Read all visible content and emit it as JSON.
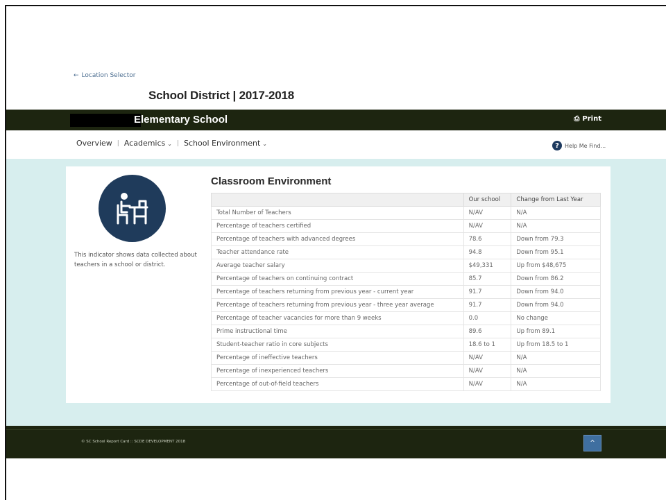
{
  "location_link": {
    "arrow": "←",
    "label": "Location Selector"
  },
  "district_title": "School District | 2017-2018",
  "school_bar": {
    "school_name": "Elementary School",
    "print_icon": "printer-icon",
    "print_label": "Print"
  },
  "nav": {
    "items": [
      {
        "label": "Overview",
        "dropdown": false
      },
      {
        "label": "Academics",
        "dropdown": true
      },
      {
        "label": "School Environment",
        "dropdown": true
      }
    ],
    "help_label": "Help Me Find..."
  },
  "indicator": {
    "icon": "teacher-at-desk-icon",
    "description": "This indicator shows data collected about teachers in a school or district."
  },
  "section": {
    "title": "Classroom Environment",
    "columns": [
      "",
      "Our school",
      "Change from Last Year"
    ],
    "rows": [
      {
        "label": "Total Number of Teachers",
        "value": "N/AV",
        "change": "N/A"
      },
      {
        "label": "Percentage of teachers certified",
        "value": "N/AV",
        "change": "N/A"
      },
      {
        "label": "Percentage of teachers with advanced degrees",
        "value": "78.6",
        "change": "Down from 79.3"
      },
      {
        "label": "Teacher attendance rate",
        "value": "94.8",
        "change": "Down from 95.1"
      },
      {
        "label": "Average teacher salary",
        "value": "$49,331",
        "change": "Up from $48,675"
      },
      {
        "label": "Percentage of teachers on continuing contract",
        "value": "85.7",
        "change": "Down from 86.2"
      },
      {
        "label": "Percentage of teachers returning from previous year - current year",
        "value": "91.7",
        "change": "Down from 94.0"
      },
      {
        "label": "Percentage of teachers returning from previous year - three year average",
        "value": "91.7",
        "change": "Down from 94.0"
      },
      {
        "label": "Percentage of teacher vacancies for more than 9 weeks",
        "value": "0.0",
        "change": "No change"
      },
      {
        "label": "Prime instructional time",
        "value": "89.6",
        "change": "Up from 89.1"
      },
      {
        "label": "Student-teacher ratio in core subjects",
        "value": "18.6 to 1",
        "change": "Up from 18.5 to 1"
      },
      {
        "label": "Percentage of ineffective teachers",
        "value": "N/AV",
        "change": "N/A"
      },
      {
        "label": "Percentage of inexperienced teachers",
        "value": "N/AV",
        "change": "N/A"
      },
      {
        "label": "Percentage of out-of-field teachers",
        "value": "N/AV",
        "change": "N/A"
      }
    ]
  },
  "footer": {
    "copyright": "© SC School Report Card :: SCDE DEVELOPMENT 2018",
    "top_button_icon": "chevron-up-icon",
    "top_button_glyph": "^"
  },
  "colors": {
    "dark_bar": "#1d2510",
    "teal_background": "#d7eeee",
    "icon_circle": "#1f3b5b",
    "link_blue": "#4a6c8f"
  }
}
